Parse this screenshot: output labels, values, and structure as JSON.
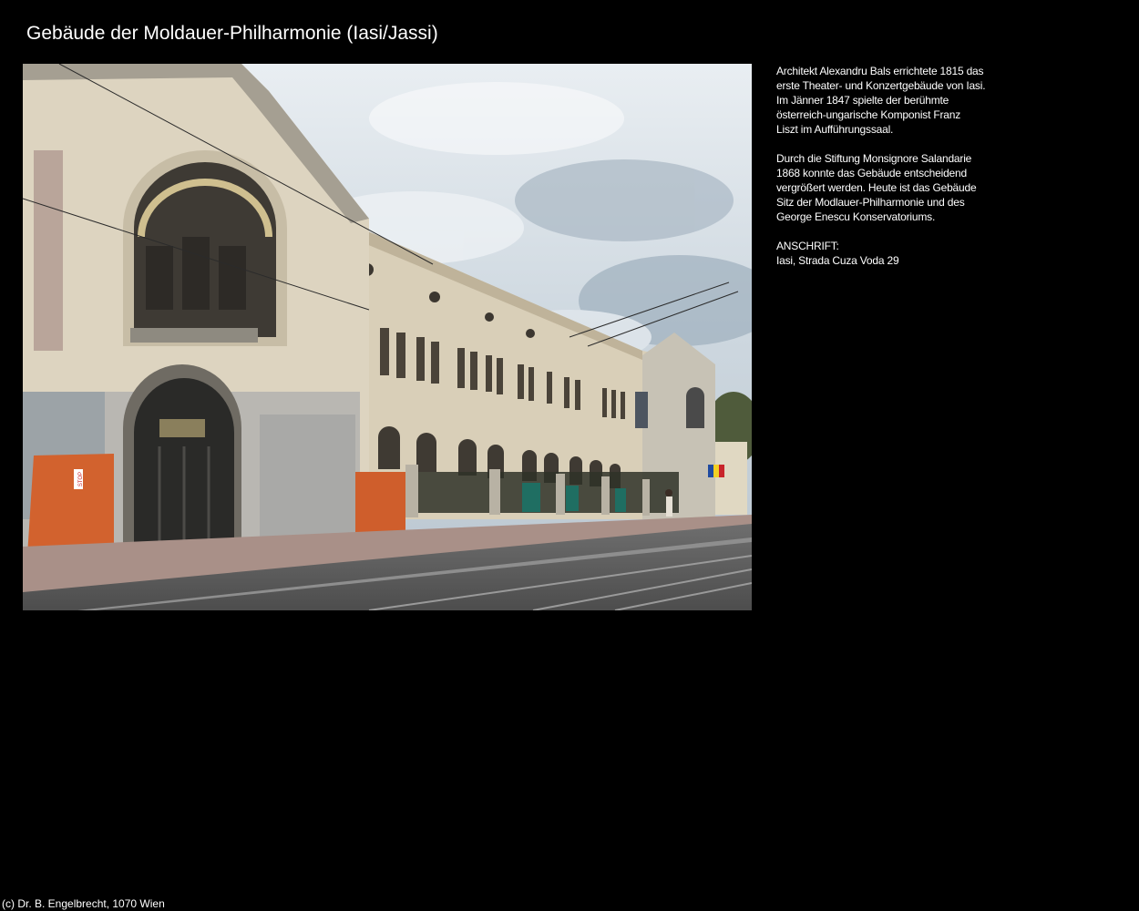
{
  "page": {
    "title": "Gebäude der Moldauer-Philharmonie (Iasi/Jassi)",
    "footer": "(c) Dr. B. Engelbrecht, 1070 Wien"
  },
  "photo": {
    "alt": "Gebäude der Moldauer-Philharmonie (Iasi/Jassi)",
    "sign_text": "STOP"
  },
  "description": {
    "paragraph1": [
      "Architekt Alexandru Bals errichtete 1815 das",
      "erste Theater- und Konzertgebäude von Iasi.",
      "Im Jänner 1847 spielte der berühmte",
      "österreich-ungarische Komponist Franz",
      "Liszt im Aufführungssaal."
    ],
    "paragraph2": [
      "Durch die Stiftung Monsignore Salandarie",
      "1868 konnte das Gebäude entscheidend",
      "vergrößert werden. Heute ist das Gebäude",
      "Sitz der Modlauer-Philharmonie und des",
      "George Enescu Konservatoriums."
    ],
    "address_label": "ANSCHRIFT:",
    "address": "Iasi, Strada Cuza Voda 29"
  },
  "colors": {
    "background": "#000000",
    "text": "#ffffff"
  }
}
